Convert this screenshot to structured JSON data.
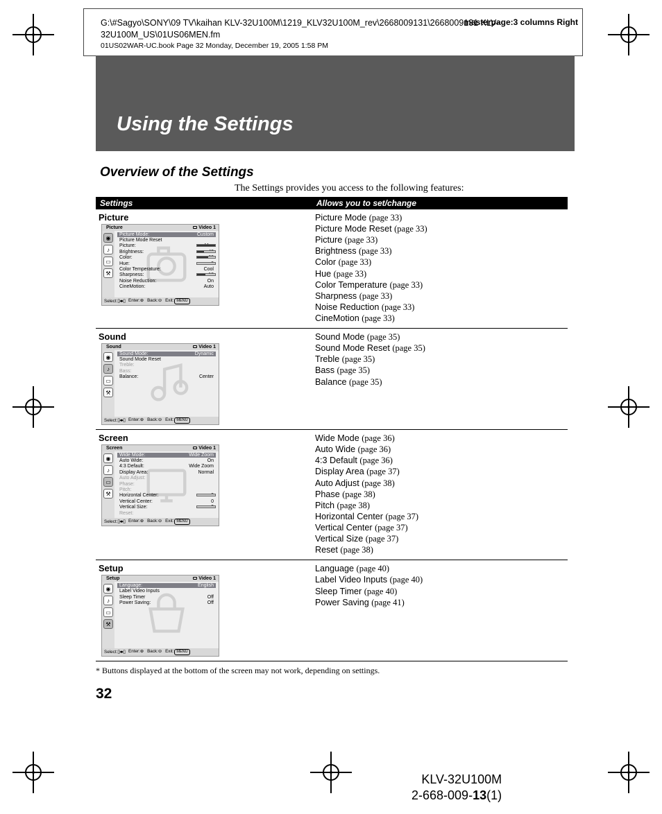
{
  "meta": {
    "path": "G:\\#Sagyo\\SONY\\09 TV\\kaihan  KLV-32U100M\\1219_KLV32U100M_rev\\2668009131\\2668009131 KLV-32U100M_US\\01US06MEN.fm",
    "masterpage": "masterpage:3 columns Right",
    "stamp": "01US02WAR-UC.book  Page 32  Monday, December 19, 2005  1:58 PM"
  },
  "banner_title": "Using the Settings",
  "section_title": "Overview of the Settings",
  "intro": "The Settings provides you access to the following features:",
  "table_headers": {
    "settings": "Settings",
    "allows": "Allows you to set/change"
  },
  "osd_common": {
    "video_label": "Video 1",
    "footer": {
      "select": "Select:",
      "enter": "Enter:",
      "back": "Back:",
      "exit": "Exit:",
      "menu": "MENU"
    }
  },
  "rows": [
    {
      "name": "Picture",
      "osd": {
        "title": "Picture",
        "highlight": {
          "label": "Picture Mode:",
          "value": "Custom"
        },
        "lines": [
          {
            "label": "Picture Mode Reset"
          },
          {
            "label": "Picture:",
            "value": "Max",
            "bar": 100
          },
          {
            "label": "Brightness:",
            "value": "40",
            "bar": 40
          },
          {
            "label": "Color:",
            "value": "60",
            "bar": 60
          },
          {
            "label": "Hue:",
            "value": "0",
            "bar": 0
          },
          {
            "label": "Color  Temperature:",
            "value": "Cool"
          },
          {
            "label": "Sharpness:",
            "value": "18",
            "bar": 48
          },
          {
            "label": "Noise Reduction:",
            "value": "On"
          },
          {
            "label": "CineMotion:",
            "value": "Auto"
          }
        ],
        "watermark": "camera"
      },
      "features": [
        {
          "label": "Picture Mode",
          "page": "33"
        },
        {
          "label": "Picture Mode Reset",
          "page": "33"
        },
        {
          "label": "Picture",
          "page": "33"
        },
        {
          "label": "Brightness",
          "page": "33"
        },
        {
          "label": "Color",
          "page": "33"
        },
        {
          "label": "Hue",
          "page": "33"
        },
        {
          "label": "Color Temperature",
          "page": "33"
        },
        {
          "label": "Sharpness",
          "page": "33"
        },
        {
          "label": "Noise Reduction",
          "page": "33"
        },
        {
          "label": "CineMotion",
          "page": "33"
        }
      ]
    },
    {
      "name": "Sound",
      "osd": {
        "title": "Sound",
        "highlight": {
          "label": "Sound  Mode:",
          "value": "Dynamic"
        },
        "lines": [
          {
            "label": "Sound  Mode Reset"
          },
          {
            "label": "Treble:",
            "dim": true
          },
          {
            "label": "Bass:",
            "dim": true
          },
          {
            "label": "Balance:",
            "value": "Center"
          }
        ],
        "watermark": "note"
      },
      "features": [
        {
          "label": "Sound Mode",
          "page": "35"
        },
        {
          "label": "Sound Mode Reset",
          "page": "35"
        },
        {
          "label": "Treble",
          "page": "35"
        },
        {
          "label": "Bass",
          "page": "35"
        },
        {
          "label": "Balance",
          "page": "35"
        }
      ]
    },
    {
      "name": "Screen",
      "osd": {
        "title": "Screen",
        "highlight": {
          "label": "Wide  Mode:",
          "value": "Wide  Zoom"
        },
        "lines": [
          {
            "label": "Auto Wide:",
            "value": "On"
          },
          {
            "label": "4:3  Default:",
            "value": "Wide  Zoom"
          },
          {
            "label": "Display Area:",
            "value": "Normal"
          },
          {
            "label": "Auto Adjust:",
            "dim": true
          },
          {
            "label": "Phase:",
            "dim": true
          },
          {
            "label": "Pitch:",
            "dim": true
          },
          {
            "label": "Horizontal Center:",
            "value": "0",
            "bar": 0
          },
          {
            "label": "Vertical Center:",
            "value": "0"
          },
          {
            "label": "Vertical Size:",
            "value": "0",
            "bar": 0
          },
          {
            "label": "Reset:",
            "dim": true
          }
        ],
        "watermark": "screen"
      },
      "features": [
        {
          "label": "Wide Mode",
          "page": "36"
        },
        {
          "label": "Auto Wide",
          "page": "36"
        },
        {
          "label": "4:3 Default",
          "page": "36"
        },
        {
          "label": "Display Area",
          "page": "37"
        },
        {
          "label": "Auto Adjust",
          "page": "38"
        },
        {
          "label": "Phase",
          "page": "38"
        },
        {
          "label": "Pitch",
          "page": "38"
        },
        {
          "label": "Horizontal Center",
          "page": "37"
        },
        {
          "label": "Vertical Center",
          "page": "37"
        },
        {
          "label": "Vertical Size",
          "page": "37"
        },
        {
          "label": "Reset",
          "page": "38"
        }
      ]
    },
    {
      "name": "Setup",
      "osd": {
        "title": "Setup",
        "highlight": {
          "label": "Language:",
          "value": "English"
        },
        "lines": [
          {
            "label": "Label  Video  Inputs"
          },
          {
            "label": "Sleep Timer",
            "value": "Off"
          },
          {
            "label": "Power  Saving:",
            "value": "Off"
          }
        ],
        "watermark": "toolbox"
      },
      "features": [
        {
          "label": "Language",
          "page": "40"
        },
        {
          "label": "Label Video Inputs",
          "page": "40"
        },
        {
          "label": "Sleep Timer",
          "page": "40"
        },
        {
          "label": "Power Saving",
          "page": "41"
        }
      ]
    }
  ],
  "footnote": "* Buttons displayed at the bottom of the screen may not work, depending on settings.",
  "page_number": "32",
  "footer": {
    "model": "KLV-32U100M",
    "doc_prefix": "2-668-009-",
    "doc_bold": "13",
    "doc_suffix": "(1)"
  }
}
